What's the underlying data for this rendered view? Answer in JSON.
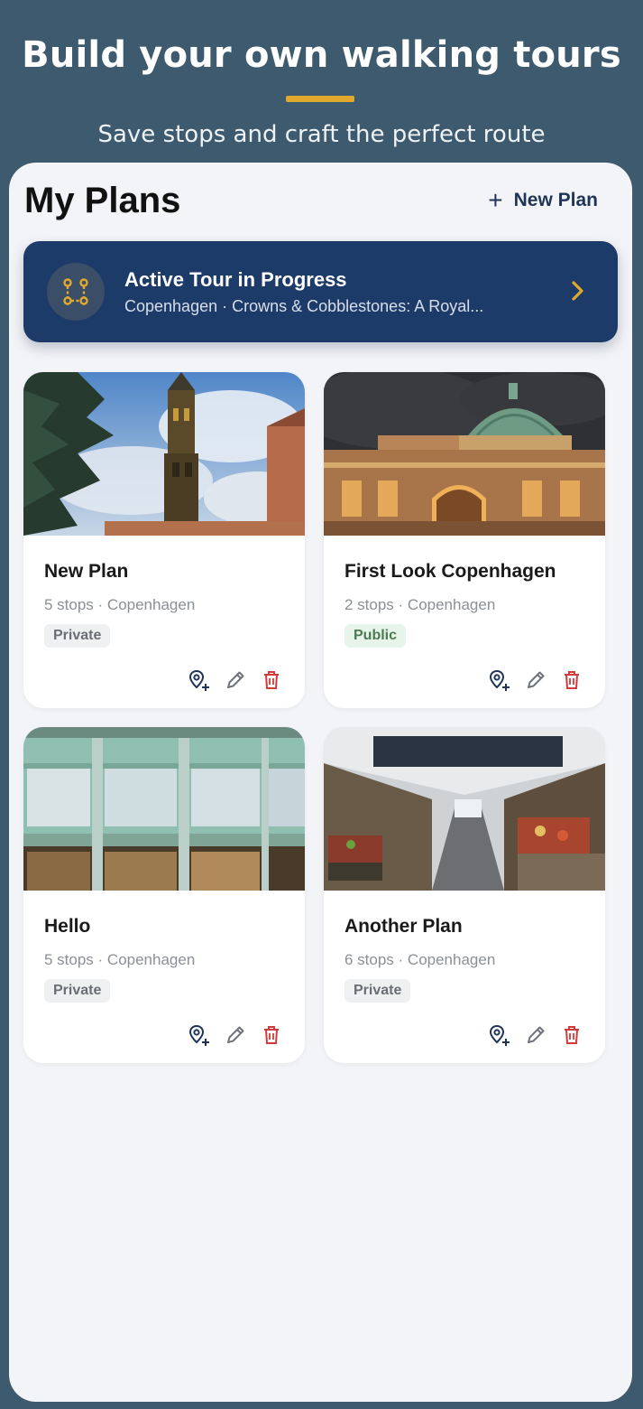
{
  "hero": {
    "title": "Build your own walking tours",
    "subtitle": "Save stops and craft the perfect route"
  },
  "header": {
    "title": "My Plans",
    "new_plan_label": "New Plan",
    "plus_icon": "+"
  },
  "active_tour": {
    "title": "Active Tour in Progress",
    "subtitle": "Copenhagen · Crowns & Cobblestones: A Royal..."
  },
  "plans": [
    {
      "title": "New Plan",
      "meta": "5 stops · Copenhagen",
      "visibility": "Private"
    },
    {
      "title": "First Look Copenhagen",
      "meta": "2 stops · Copenhagen",
      "visibility": "Public"
    },
    {
      "title": "Hello",
      "meta": "5 stops · Copenhagen",
      "visibility": "Private"
    },
    {
      "title": "Another Plan",
      "meta": "6 stops · Copenhagen",
      "visibility": "Private"
    }
  ],
  "icons": {
    "banner": "route-icon",
    "banner_chevron": "chevron-right-icon",
    "add_stop": "map-pin-plus-icon",
    "edit": "pencil-icon",
    "delete": "trash-icon"
  },
  "colors": {
    "background": "#3d5a6e",
    "accent": "#e0a92e",
    "banner": "#1d3b68",
    "delete": "#d23a3a",
    "text_dark": "#1a1a1a"
  }
}
